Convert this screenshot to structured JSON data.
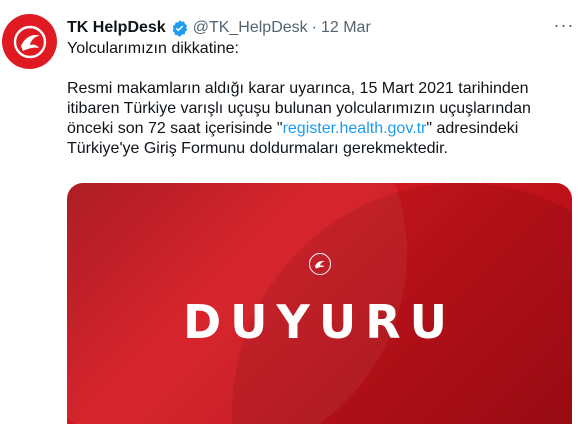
{
  "tweet": {
    "display_name": "TK HelpDesk",
    "handle": "@TK_HelpDesk",
    "separator": "·",
    "date": "12 Mar",
    "more_label": "···",
    "greeting": "Yolcularımızın dikkatine:",
    "body_before_link": "Resmi makamların aldığı karar uyarınca, 15 Mart 2021 tarihinden itibaren Türkiye varışlı uçuşu bulunan yolcularımızın uçuşlarından önceki son 72 saat içerisinde \"",
    "link_text": "register.health.gov.tr",
    "body_after_link": "\" adresindeki Türkiye'ye Giriş Formunu doldurmaları gerekmektedir.",
    "media_title": "DUYURU"
  },
  "colors": {
    "brand_red": "#e01a22",
    "link_blue": "#1d9bf0",
    "verified_blue": "#1d9bf0",
    "text": "#0f1419",
    "secondary": "#536471"
  },
  "icons": {
    "avatar": "turkish-airlines-logo-icon",
    "verified": "verified-badge-icon",
    "more": "more-options-icon",
    "media_logo": "turkish-airlines-logo-icon"
  }
}
